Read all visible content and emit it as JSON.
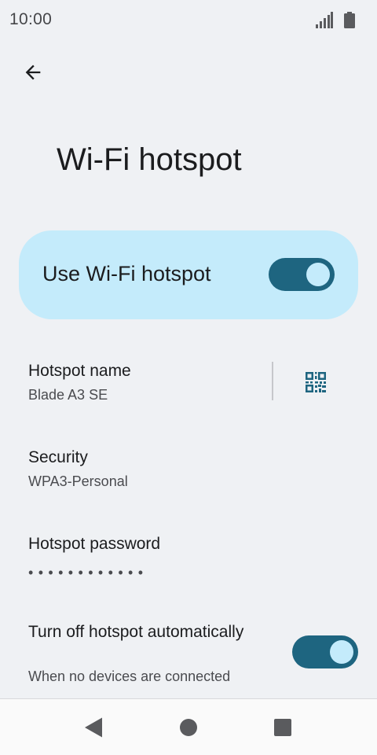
{
  "status_bar": {
    "time": "10:00",
    "icons": [
      "signal-icon",
      "battery-icon"
    ]
  },
  "header": {
    "back_icon": "arrow-back-icon",
    "title": "Wi-Fi hotspot"
  },
  "main_switch": {
    "label": "Use Wi-Fi hotspot",
    "checked": true
  },
  "preferences": {
    "hotspot_name": {
      "title": "Hotspot name",
      "summary": "Blade A3 SE",
      "action_icon": "qr-code-icon"
    },
    "security": {
      "title": "Security",
      "summary": "WPA3-Personal"
    },
    "password": {
      "title": "Hotspot password",
      "summary": "••••••••••••"
    },
    "auto_off": {
      "title": "Turn off hotspot automatically",
      "summary": "When no devices are connected",
      "checked": true
    }
  },
  "nav_bar": {
    "icons": [
      "nav-back-icon",
      "nav-home-icon",
      "nav-recents-icon"
    ]
  },
  "colors": {
    "background": "#eff1f4",
    "card": "#c4ebfb",
    "accent": "#1e6580",
    "text_primary": "#1b1c1e",
    "text_secondary": "#4a4b4f"
  }
}
